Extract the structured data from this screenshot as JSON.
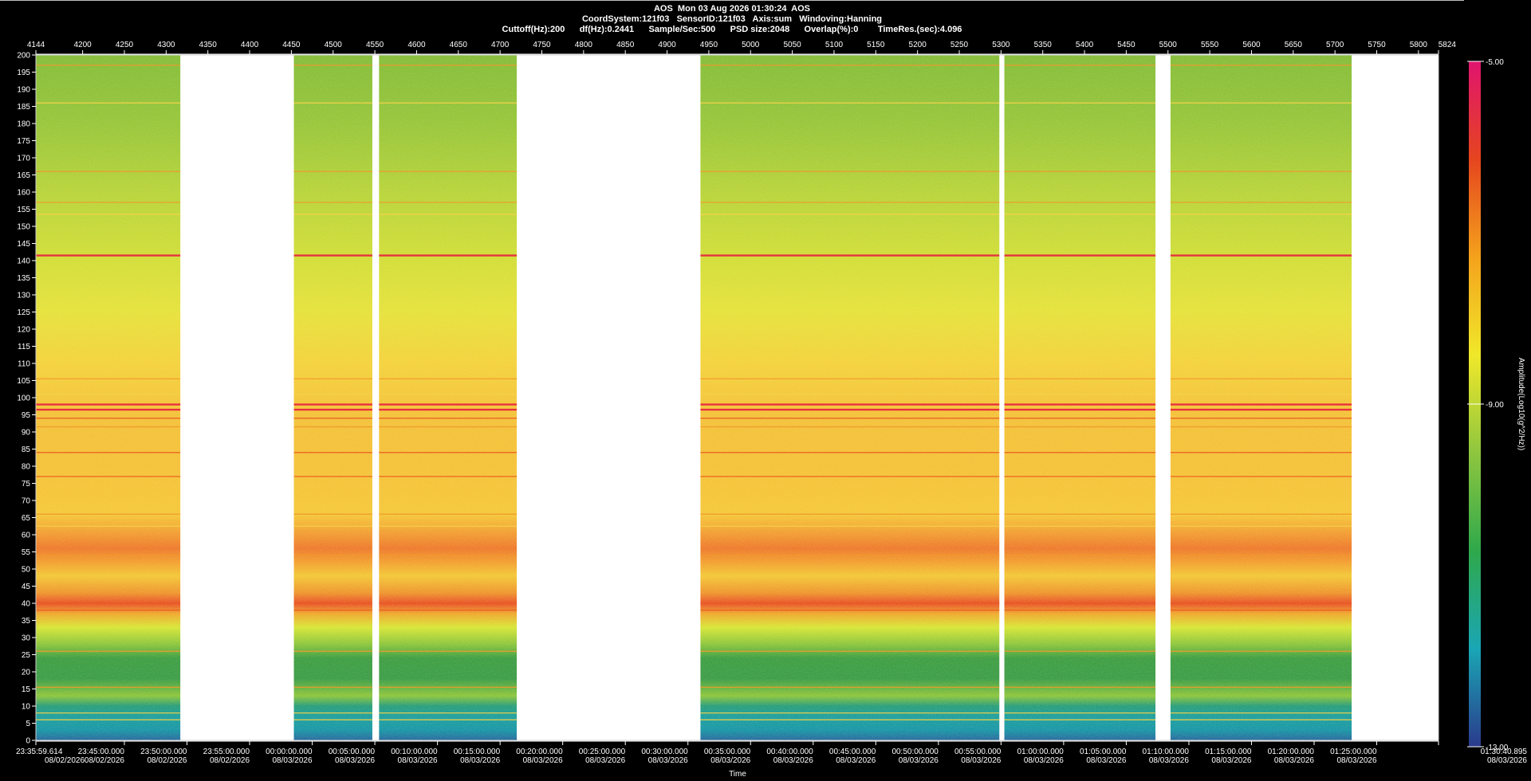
{
  "header": {
    "line1": "AOS  Mon 03 Aug 2026 01:30:24  AOS",
    "line2": "CoordSystem:121f03   SensorID:121f03   Axis:sum   Windoving:Hanning",
    "line3": "Cuttoff(Hz):200      df(Hz):0.2441      Sample/Sec:500      PSD size:2048      Overlap(%):0        TimeRes.(sec):4.096"
  },
  "chart_data": {
    "type": "heatmap",
    "xlabel": "Time",
    "ylabel": "",
    "ylim": [
      0,
      200
    ],
    "yticks": [
      0,
      5,
      10,
      15,
      20,
      25,
      30,
      35,
      40,
      45,
      50,
      55,
      60,
      65,
      70,
      75,
      80,
      85,
      90,
      95,
      100,
      105,
      110,
      115,
      120,
      125,
      130,
      135,
      140,
      145,
      150,
      155,
      160,
      165,
      170,
      175,
      180,
      185,
      190,
      195,
      200
    ],
    "top_axis_range": [
      4144,
      5824
    ],
    "top_ticks": [
      "4144",
      "4200",
      "4250",
      "4300",
      "4350",
      "4400",
      "4450",
      "4500",
      "4550",
      "4600",
      "4650",
      "4700",
      "4750",
      "4800",
      "4850",
      "4900",
      "4950",
      "5000",
      "5050",
      "5100",
      "5150",
      "5200",
      "5250",
      "5300",
      "5350",
      "5400",
      "5450",
      "5500",
      "5550",
      "5600",
      "5650",
      "5700",
      "5750",
      "5800",
      "5824"
    ],
    "bottom_ticks": [
      {
        "s": 4144,
        "time": "23:35:59.614",
        "date": "08/02/2026"
      },
      {
        "s": 4250,
        "time": "23:45:00.000",
        "date": "08/02/2026"
      },
      {
        "s": 4325,
        "time": "23:50:00.000",
        "date": "08/02/2026"
      },
      {
        "s": 4400,
        "time": "23:55:00.000",
        "date": "08/02/2026"
      },
      {
        "s": 4475,
        "time": "00:00:00.000",
        "date": "08/03/2026"
      },
      {
        "s": 4550,
        "time": "00:05:00.000",
        "date": "08/03/2026"
      },
      {
        "s": 4625,
        "time": "00:10:00.000",
        "date": "08/03/2026"
      },
      {
        "s": 4700,
        "time": "00:15:00.000",
        "date": "08/03/2026"
      },
      {
        "s": 4775,
        "time": "00:20:00.000",
        "date": "08/03/2026"
      },
      {
        "s": 4850,
        "time": "00:25:00.000",
        "date": "08/03/2026"
      },
      {
        "s": 4925,
        "time": "00:30:00.000",
        "date": "08/03/2026"
      },
      {
        "s": 5000,
        "time": "00:35:00.000",
        "date": "08/03/2026"
      },
      {
        "s": 5075,
        "time": "00:40:00.000",
        "date": "08/03/2026"
      },
      {
        "s": 5150,
        "time": "00:45:00.000",
        "date": "08/03/2026"
      },
      {
        "s": 5225,
        "time": "00:50:00.000",
        "date": "08/03/2026"
      },
      {
        "s": 5300,
        "time": "00:55:00.000",
        "date": "08/03/2026"
      },
      {
        "s": 5375,
        "time": "01:00:00.000",
        "date": "08/03/2026"
      },
      {
        "s": 5450,
        "time": "01:05:00.000",
        "date": "08/03/2026"
      },
      {
        "s": 5525,
        "time": "01:10:00.000",
        "date": "08/03/2026"
      },
      {
        "s": 5600,
        "time": "01:15:00.000",
        "date": "08/03/2026"
      },
      {
        "s": 5675,
        "time": "01:20:00.000",
        "date": "08/03/2026"
      },
      {
        "s": 5750,
        "time": "01:25:00.000",
        "date": "08/03/2026"
      },
      {
        "s": 5824,
        "time": "01:30:40.895",
        "date": "08/03/2026"
      }
    ],
    "data_segments": [
      [
        4144,
        4317
      ],
      [
        4453,
        4547
      ],
      [
        4555,
        4720
      ],
      [
        4940,
        5298
      ],
      [
        5304,
        5485
      ],
      [
        5503,
        5720
      ]
    ],
    "lines": [
      {
        "freq": 197,
        "level": 0.6
      },
      {
        "freq": 186,
        "level": 0.3
      },
      {
        "freq": 166,
        "level": 0.45
      },
      {
        "freq": 157,
        "level": 0.55
      },
      {
        "freq": 153.5,
        "level": 0.4
      },
      {
        "freq": 141.5,
        "level": 0.95
      },
      {
        "freq": 105.5,
        "level": 0.6
      },
      {
        "freq": 101,
        "level": 0.35
      },
      {
        "freq": 98,
        "level": 0.95
      },
      {
        "freq": 96.5,
        "level": 0.9
      },
      {
        "freq": 94,
        "level": 0.75
      },
      {
        "freq": 91.5,
        "level": 0.5
      },
      {
        "freq": 84,
        "level": 0.7
      },
      {
        "freq": 77,
        "level": 0.8
      },
      {
        "freq": 66,
        "level": 0.45
      },
      {
        "freq": 62.5,
        "level": 0.4
      },
      {
        "freq": 54,
        "level": 0.55
      },
      {
        "freq": 40,
        "level": 0.8
      },
      {
        "freq": 38,
        "level": 0.7
      },
      {
        "freq": 26,
        "level": 0.45
      },
      {
        "freq": 15.5,
        "level": 0.45
      },
      {
        "freq": 8,
        "level": 0.3
      },
      {
        "freq": 6,
        "level": 0.25
      }
    ],
    "colorbar": {
      "label": "Amplitude(Log10(g^2/Hz))",
      "max_label": "-5.00",
      "mid_label": "-9.00",
      "min_label": "-13.00",
      "range": [
        -13,
        -5
      ],
      "stops": [
        "#2a3a8c",
        "#1aa6b4",
        "#2fa84b",
        "#8ec63f",
        "#f0e82a",
        "#f4a21c",
        "#e5451f",
        "#e0146e"
      ]
    },
    "grid": false
  }
}
